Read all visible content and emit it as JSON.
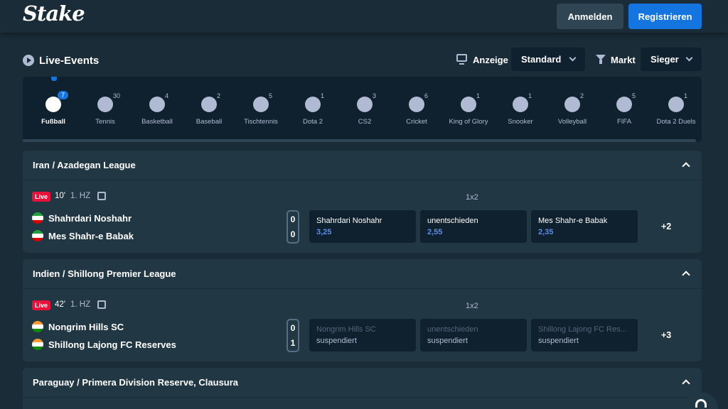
{
  "header": {
    "logo": "Stake",
    "login_label": "Anmelden",
    "register_label": "Registrieren"
  },
  "section": {
    "title": "Live-Events",
    "display_label": "Anzeige",
    "display_value": "Standard",
    "market_label": "Markt",
    "market_value": "Sieger"
  },
  "sports": [
    {
      "label": "Fußball",
      "count": "7",
      "icon": "soccer-ball-icon",
      "active": true
    },
    {
      "label": "Tennis",
      "count": "30",
      "icon": "tennis-ball-icon"
    },
    {
      "label": "Basketball",
      "count": "4",
      "icon": "basketball-icon"
    },
    {
      "label": "Baseball",
      "count": "2",
      "icon": "baseball-icon"
    },
    {
      "label": "Tischtennis",
      "count": "5",
      "icon": "table-tennis-icon"
    },
    {
      "label": "Dota 2",
      "count": "1",
      "icon": "dota2-icon"
    },
    {
      "label": "CS2",
      "count": "3",
      "icon": "cs2-icon"
    },
    {
      "label": "Cricket",
      "count": "6",
      "icon": "cricket-icon"
    },
    {
      "label": "King of Glory",
      "count": "1",
      "icon": "king-of-glory-icon"
    },
    {
      "label": "Snooker",
      "count": "1",
      "icon": "snooker-icon"
    },
    {
      "label": "Volleyball",
      "count": "2",
      "icon": "volleyball-icon"
    },
    {
      "label": "FIFA",
      "count": "5",
      "icon": "fifa-icon"
    },
    {
      "label": "Dota 2 Duels",
      "count": "1",
      "icon": "dota2-duels-icon"
    }
  ],
  "leagues": [
    {
      "name": "Iran / Azadegan League",
      "match": {
        "live": "Live",
        "minute": "10'",
        "period": "1. HZ",
        "market": "1x2",
        "home": "Shahrdari Noshahr",
        "away": "Mes Shahr-e Babak",
        "home_score": "0",
        "away_score": "0",
        "odds": [
          {
            "name": "Shahrdari Noshahr",
            "value": "3,25"
          },
          {
            "name": "unentschieden",
            "value": "2,55"
          },
          {
            "name": "Mes Shahr-e Babak",
            "value": "2,35"
          }
        ],
        "more": "+2"
      }
    },
    {
      "name": "Indien / Shillong Premier League",
      "match": {
        "live": "Live",
        "minute": "42'",
        "period": "1. HZ",
        "market": "1x2",
        "home": "Nongrim Hills SC",
        "away": "Shillong Lajong FC Reserves",
        "home_score": "0",
        "away_score": "1",
        "odds": [
          {
            "name": "Nongrim Hills SC",
            "value": "suspendiert"
          },
          {
            "name": "unentschieden",
            "value": "suspendiert"
          },
          {
            "name": "Shillong Lajong FC Res...",
            "value": "suspendiert"
          }
        ],
        "more": "+3"
      }
    },
    {
      "name": "Paraguay / Primera Division Reserve, Clausura"
    }
  ],
  "colors": {
    "background": "#1a2c38",
    "panel": "#213743",
    "dark": "#0f212e",
    "accent": "#1475e1",
    "live": "#e9113c",
    "odds_text": "#5b8dee"
  }
}
